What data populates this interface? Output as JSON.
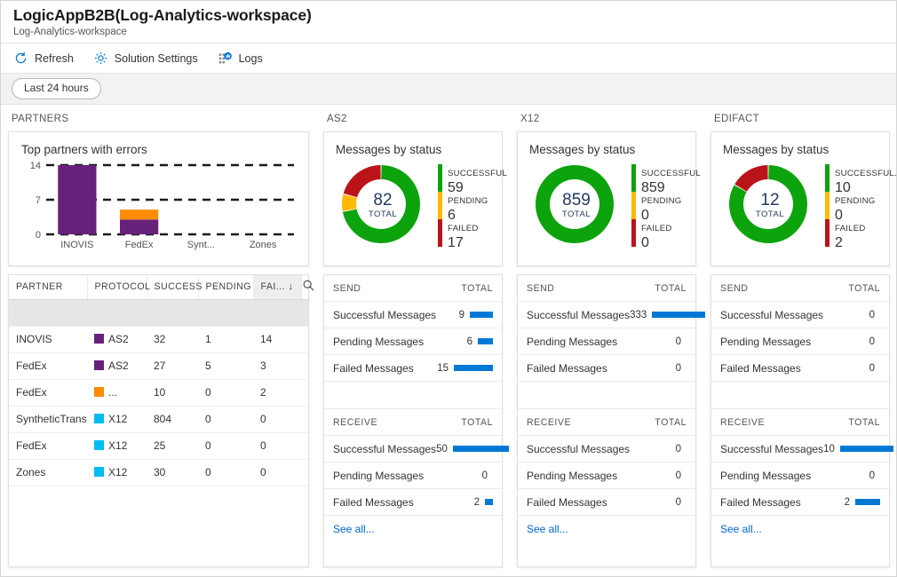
{
  "header": {
    "title": "LogicAppB2B(Log-Analytics-workspace)",
    "subtitle": "Log-Analytics-workspace"
  },
  "toolbar": {
    "refresh_label": "Refresh",
    "refresh_icon": "refresh-icon",
    "settings_label": "Solution Settings",
    "settings_icon": "gear-icon",
    "logs_label": "Logs",
    "logs_icon": "logs-chart-icon"
  },
  "filter": {
    "time_range": "Last 24 hours"
  },
  "colors": {
    "green": "#0CA30C",
    "amber": "#FFB900",
    "red": "#BA141A",
    "purple": "#68217A",
    "orange": "#FF8C00",
    "cyan": "#00BCF2",
    "blue": "#0078D4",
    "link": "#0066CC"
  },
  "partners": {
    "column_title": "PARTNERS",
    "chart_data": {
      "type": "bar",
      "title": "Top partners with errors",
      "categories": [
        "INOVIS",
        "FedEx",
        "Synt...",
        "Zones"
      ],
      "series": [
        {
          "name": "AS2",
          "color": "#68217A",
          "values": [
            14,
            3,
            0,
            0
          ]
        },
        {
          "name": "EDIFACT",
          "color": "#FF8C00",
          "values": [
            0,
            2,
            0,
            0
          ]
        }
      ],
      "stacked": true,
      "ylim": [
        0,
        14
      ],
      "yticks": [
        0,
        7,
        14
      ],
      "ytick_labels": [
        "0",
        "7",
        "14"
      ],
      "xlabel": "",
      "ylabel": "",
      "grid": "dashed-horizontal"
    },
    "table": {
      "columns": [
        "PARTNER",
        "PROTOCOL",
        "SUCCESS",
        "PENDING",
        "FAI..."
      ],
      "sorted_column": "FAI...",
      "sort_direction": "desc",
      "search_icon": "search-icon",
      "rows": [
        {
          "partner": "INOVIS",
          "protocol": "AS2",
          "protocol_color": "#68217A",
          "success": "32",
          "pending": "1",
          "failed": "14"
        },
        {
          "partner": "FedEx",
          "protocol": "AS2",
          "protocol_color": "#68217A",
          "success": "27",
          "pending": "5",
          "failed": "3"
        },
        {
          "partner": "FedEx",
          "protocol": "...",
          "protocol_color": "#FF8C00",
          "success": "10",
          "pending": "0",
          "failed": "2"
        },
        {
          "partner": "SyntheticTrans",
          "protocol": "X12",
          "protocol_color": "#00BCF2",
          "success": "804",
          "pending": "0",
          "failed": "0"
        },
        {
          "partner": "FedEx",
          "protocol": "X12",
          "protocol_color": "#00BCF2",
          "success": "25",
          "pending": "0",
          "failed": "0"
        },
        {
          "partner": "Zones",
          "protocol": "X12",
          "protocol_color": "#00BCF2",
          "success": "30",
          "pending": "0",
          "failed": "0"
        }
      ]
    }
  },
  "protocols": [
    {
      "column_title": "AS2",
      "chart_data": {
        "type": "pie",
        "title": "Messages by status",
        "labels": [
          "SUCCESSFUL",
          "PENDING",
          "FAILED"
        ],
        "values": [
          59,
          6,
          17
        ],
        "colors": [
          "#0CA30C",
          "#FFB900",
          "#BA141A"
        ],
        "total": 82,
        "total_label": "TOTAL",
        "donut": true
      },
      "legend": [
        {
          "name": "SUCCESSFUL",
          "value": "59",
          "color": "#0CA30C"
        },
        {
          "name": "PENDING",
          "value": "6",
          "color": "#FFB900"
        },
        {
          "name": "FAILED",
          "value": "17",
          "color": "#BA141A"
        }
      ],
      "send": {
        "header": "SEND",
        "total_header": "TOTAL",
        "rows": [
          {
            "label": "Successful Messages",
            "value": "9",
            "bar": 26
          },
          {
            "label": "Pending Messages",
            "value": "6",
            "bar": 17
          },
          {
            "label": "Failed Messages",
            "value": "15",
            "bar": 44
          }
        ]
      },
      "receive": {
        "header": "RECEIVE",
        "total_header": "TOTAL",
        "rows": [
          {
            "label": "Successful Messages",
            "value": "50",
            "bar": 63
          },
          {
            "label": "Pending Messages",
            "value": "0",
            "bar": 0
          },
          {
            "label": "Failed Messages",
            "value": "2",
            "bar": 9
          }
        ]
      },
      "see_all": "See all..."
    },
    {
      "column_title": "X12",
      "chart_data": {
        "type": "pie",
        "title": "Messages by status",
        "labels": [
          "SUCCESSFUL",
          "PENDING",
          "FAILED"
        ],
        "values": [
          859,
          0,
          0
        ],
        "colors": [
          "#0CA30C",
          "#FFB900",
          "#BA141A"
        ],
        "total": 859,
        "total_label": "TOTAL",
        "donut": true
      },
      "legend": [
        {
          "name": "SUCCESSFUL",
          "value": "859",
          "color": "#0CA30C"
        },
        {
          "name": "PENDING",
          "value": "0",
          "color": "#FFB900"
        },
        {
          "name": "FAILED",
          "value": "0",
          "color": "#BA141A"
        }
      ],
      "send": {
        "header": "SEND",
        "total_header": "TOTAL",
        "rows": [
          {
            "label": "Successful Messages",
            "value": "333",
            "bar": 60
          },
          {
            "label": "Pending Messages",
            "value": "0",
            "bar": 0
          },
          {
            "label": "Failed Messages",
            "value": "0",
            "bar": 0
          }
        ]
      },
      "receive": {
        "header": "RECEIVE",
        "total_header": "TOTAL",
        "rows": [
          {
            "label": "Successful Messages",
            "value": "0",
            "bar": 0
          },
          {
            "label": "Pending Messages",
            "value": "0",
            "bar": 0
          },
          {
            "label": "Failed Messages",
            "value": "0",
            "bar": 0
          }
        ]
      },
      "see_all": "See all..."
    },
    {
      "column_title": "EDIFACT",
      "chart_data": {
        "type": "pie",
        "title": "Messages by status",
        "labels": [
          "SUCCESSFUL.",
          "PENDING",
          "FAILED"
        ],
        "values": [
          10,
          0,
          2
        ],
        "colors": [
          "#0CA30C",
          "#FFB900",
          "#BA141A"
        ],
        "total": 12,
        "total_label": "TOTAL",
        "donut": true
      },
      "legend": [
        {
          "name": "SUCCESSFUL.",
          "value": "10",
          "color": "#0CA30C"
        },
        {
          "name": "PENDING",
          "value": "0",
          "color": "#FFB900"
        },
        {
          "name": "FAILED",
          "value": "2",
          "color": "#BA141A"
        }
      ],
      "send": {
        "header": "SEND",
        "total_header": "TOTAL",
        "rows": [
          {
            "label": "Successful Messages",
            "value": "0",
            "bar": 0
          },
          {
            "label": "Pending Messages",
            "value": "0",
            "bar": 0
          },
          {
            "label": "Failed Messages",
            "value": "0",
            "bar": 0
          }
        ]
      },
      "receive": {
        "header": "RECEIVE",
        "total_header": "TOTAL",
        "rows": [
          {
            "label": "Successful Messages",
            "value": "10",
            "bar": 60
          },
          {
            "label": "Pending Messages",
            "value": "0",
            "bar": 0
          },
          {
            "label": "Failed Messages",
            "value": "2",
            "bar": 28
          }
        ]
      },
      "see_all": "See all..."
    }
  ]
}
